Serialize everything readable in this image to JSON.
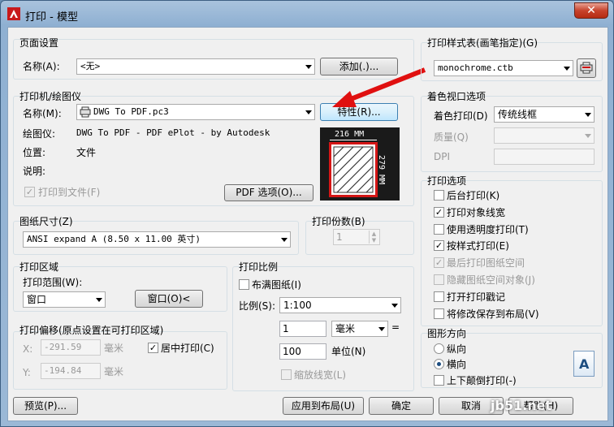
{
  "title": "打印 - 模型",
  "close": "✕",
  "page_setup": {
    "group": "页面设置",
    "name_label": "名称(A):",
    "name_value": "<无>",
    "add_button": "添加(.)..."
  },
  "printer": {
    "group": "打印机/绘图仪",
    "name_label": "名称(M):",
    "name_value": "DWG To PDF.pc3",
    "properties_button": "特性(R)...",
    "plotter_label": "绘图仪:",
    "plotter_value": "DWG To PDF - PDF ePlot - by Autodesk",
    "location_label": "位置:",
    "location_value": "文件",
    "description_label": "说明:",
    "print_to_file": "打印到文件(F)",
    "pdf_options_button": "PDF 选项(O)...",
    "preview_width": "216 MM",
    "preview_height": "279 MM"
  },
  "paper_size": {
    "group": "图纸尺寸(Z)",
    "value": "ANSI expand A (8.50 x 11.00 英寸)"
  },
  "copies": {
    "group": "打印份数(B)",
    "value": "1"
  },
  "plot_area": {
    "group": "打印区域",
    "range_label": "打印范围(W):",
    "range_value": "窗口",
    "window_button": "窗口(O)<"
  },
  "plot_offset": {
    "group": "打印偏移(原点设置在可打印区域)",
    "x_label": "X:",
    "x_value": "-291.59",
    "x_unit": "毫米",
    "y_label": "Y:",
    "y_value": "-194.84",
    "y_unit": "毫米",
    "center": "居中打印(C)"
  },
  "plot_scale": {
    "group": "打印比例",
    "fit": "布满图纸(I)",
    "scale_label": "比例(S):",
    "scale_value": "1:100",
    "value1": "1",
    "unit1": "毫米",
    "equals": "=",
    "value2": "100",
    "unit2": "单位(N)",
    "lineweights": "缩放线宽(L)"
  },
  "plot_style": {
    "group": "打印样式表(画笔指定)(G)",
    "value": "monochrome.ctb"
  },
  "shaded": {
    "group": "着色视口选项",
    "shade_label": "着色打印(D)",
    "shade_value": "传统线框",
    "quality_label": "质量(Q)",
    "dpi_label": "DPI"
  },
  "options": {
    "group": "打印选项",
    "items": [
      {
        "label": "后台打印(K)",
        "checked": false,
        "disabled": false
      },
      {
        "label": "打印对象线宽",
        "checked": true,
        "disabled": false
      },
      {
        "label": "使用透明度打印(T)",
        "checked": false,
        "disabled": false
      },
      {
        "label": "按样式打印(E)",
        "checked": true,
        "disabled": false
      },
      {
        "label": "最后打印图纸空间",
        "checked": true,
        "disabled": true
      },
      {
        "label": "隐藏图纸空间对象(J)",
        "checked": false,
        "disabled": true
      },
      {
        "label": "打开打印戳记",
        "checked": false,
        "disabled": false
      },
      {
        "label": "将修改保存到布局(V)",
        "checked": false,
        "disabled": false
      }
    ]
  },
  "orientation": {
    "group": "图形方向",
    "portrait": "纵向",
    "landscape": "横向",
    "upside_down": "上下颠倒打印(-)",
    "icon_letter": "A"
  },
  "footer": {
    "preview": "预览(P)...",
    "apply": "应用到布局(U)",
    "ok": "确定",
    "cancel": "取消",
    "help": "帮助(H)"
  },
  "watermark": "jb51.net"
}
